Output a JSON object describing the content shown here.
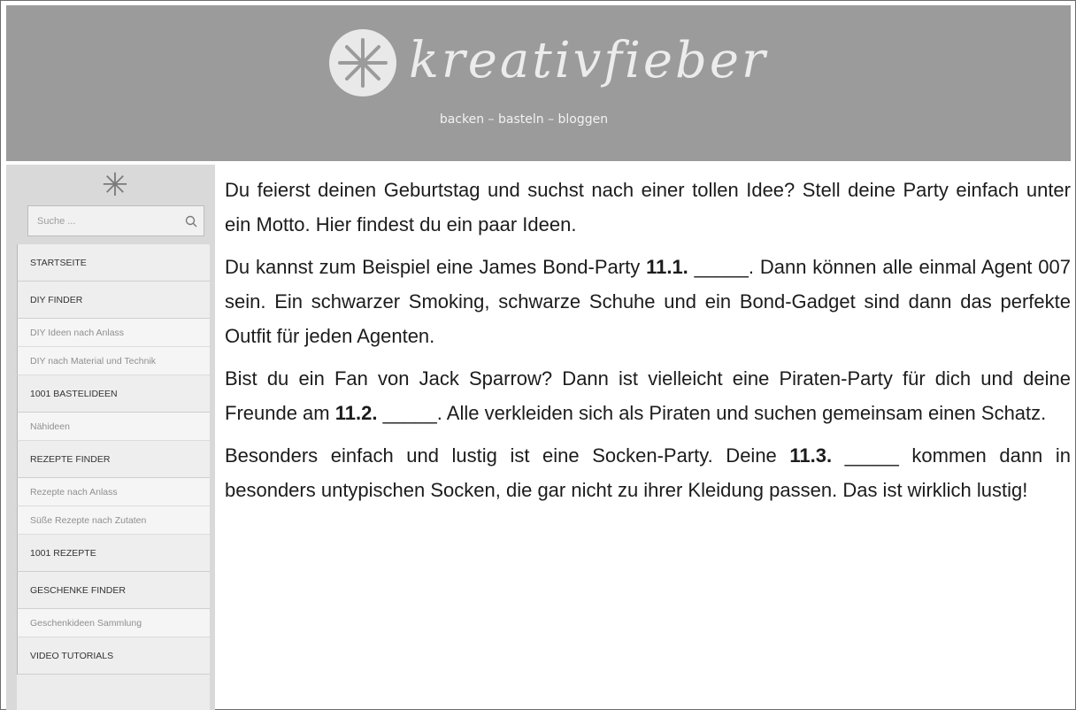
{
  "header": {
    "logo_text": "kreativfieber",
    "tagline": "backen – basteln – bloggen"
  },
  "sidebar": {
    "search_placeholder": "Suche ...",
    "menu": [
      {
        "label": "STARTSEITE",
        "kind": "top"
      },
      {
        "label": "DIY FINDER",
        "kind": "top"
      },
      {
        "label": "DIY Ideen nach Anlass",
        "kind": "sub"
      },
      {
        "label": "DIY nach Material und Technik",
        "kind": "sub"
      },
      {
        "label": "1001 BASTELIDEEN",
        "kind": "top"
      },
      {
        "label": "Nähideen",
        "kind": "sub"
      },
      {
        "label": "REZEPTE FINDER",
        "kind": "top"
      },
      {
        "label": "Rezepte nach Anlass",
        "kind": "sub"
      },
      {
        "label": "Süße Rezepte nach Zutaten",
        "kind": "sub"
      },
      {
        "label": "1001 REZEPTE",
        "kind": "top"
      },
      {
        "label": "GESCHENKE FINDER",
        "kind": "top"
      },
      {
        "label": "Geschenkideen Sammlung",
        "kind": "sub"
      },
      {
        "label": "VIDEO TUTORIALS",
        "kind": "top"
      }
    ]
  },
  "article": {
    "p1": "Du feierst deinen Geburtstag und suchst nach einer tollen Idee? Stell deine Party einfach unter ein Motto. Hier findest du ein paar Ideen.",
    "p2_before": "Du kannst zum Beispiel eine James Bond-Party ",
    "p2_gap": "11.1.",
    "p2_blank": "_____",
    "p2_after": ". Dann können alle einmal Agent 007 sein. Ein schwarzer Smoking, schwarze Schuhe und ein Bond-Gadget sind dann das perfekte Outfit für jeden Agenten.",
    "p3_before": "Bist du ein Fan von Jack Sparrow? Dann ist vielleicht eine Piraten-Party für dich und deine Freunde am ",
    "p3_gap": "11.2.",
    "p3_blank": "_____",
    "p3_after": ". Alle verkleiden sich als Piraten und suchen gemeinsam einen Schatz.",
    "p4_before": "Besonders einfach und lustig ist eine Socken-Party. Deine ",
    "p4_gap": "11.3.",
    "p4_blank": "_____",
    "p4_after": " kommen dann in besonders untypischen Socken, die gar nicht zu ihrer Kleidung passen. Das ist wirklich lustig!"
  }
}
